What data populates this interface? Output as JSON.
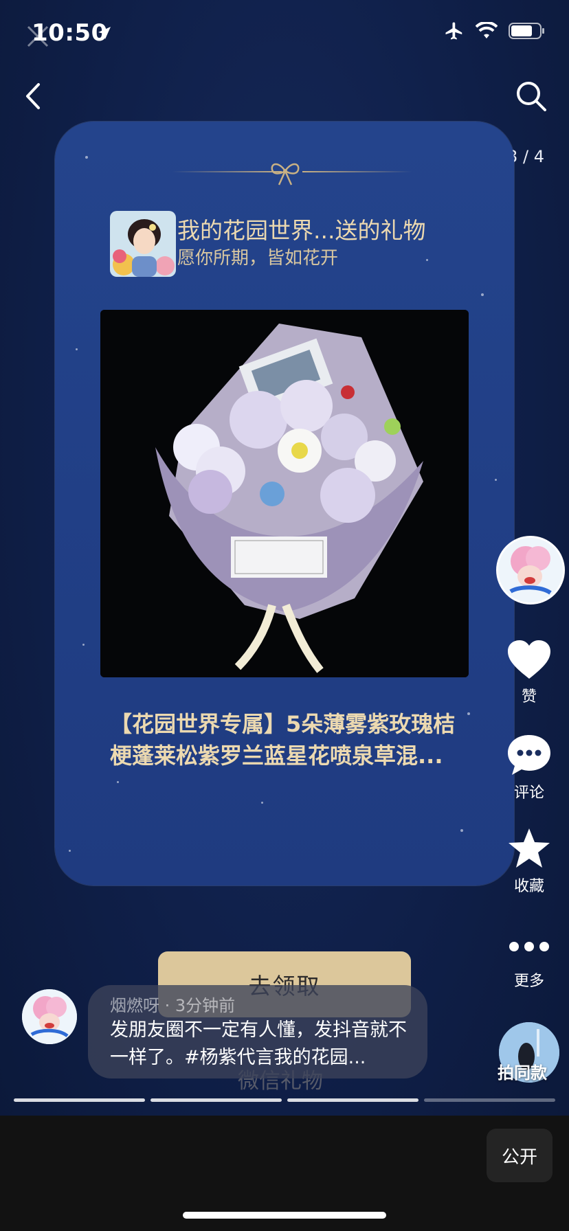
{
  "status_bar": {
    "time": "10:50"
  },
  "nav": {
    "page_indicator": "3 / 4"
  },
  "card": {
    "sender_title": "我的花园世界...送的礼物",
    "sender_subtitle": "愿你所期，皆如花开",
    "product_name": "【花园世界专属】5朵薄雾紫玫瑰桔梗蓬莱松紫罗兰蓝星花喷泉草混..."
  },
  "rail": {
    "like_label": "赞",
    "comment_label": "评论",
    "collect_label": "收藏",
    "more_label": "更多",
    "same_label": "拍同款"
  },
  "claim_button": "去领取",
  "wechat_gift": "微信礼物",
  "comment": {
    "meta": "烟燃呀 · 3分钟前",
    "text": "发朋友圈不一定有人懂，发抖音就不一样了。#杨紫代言我的花园..."
  },
  "progress": {
    "total": 4,
    "completed": 3
  },
  "bottom": {
    "public_label": "公开"
  },
  "colors": {
    "accent_gold": "#dcc79b",
    "card_blue": "#223f87",
    "bg_navy": "#0f1f48"
  }
}
